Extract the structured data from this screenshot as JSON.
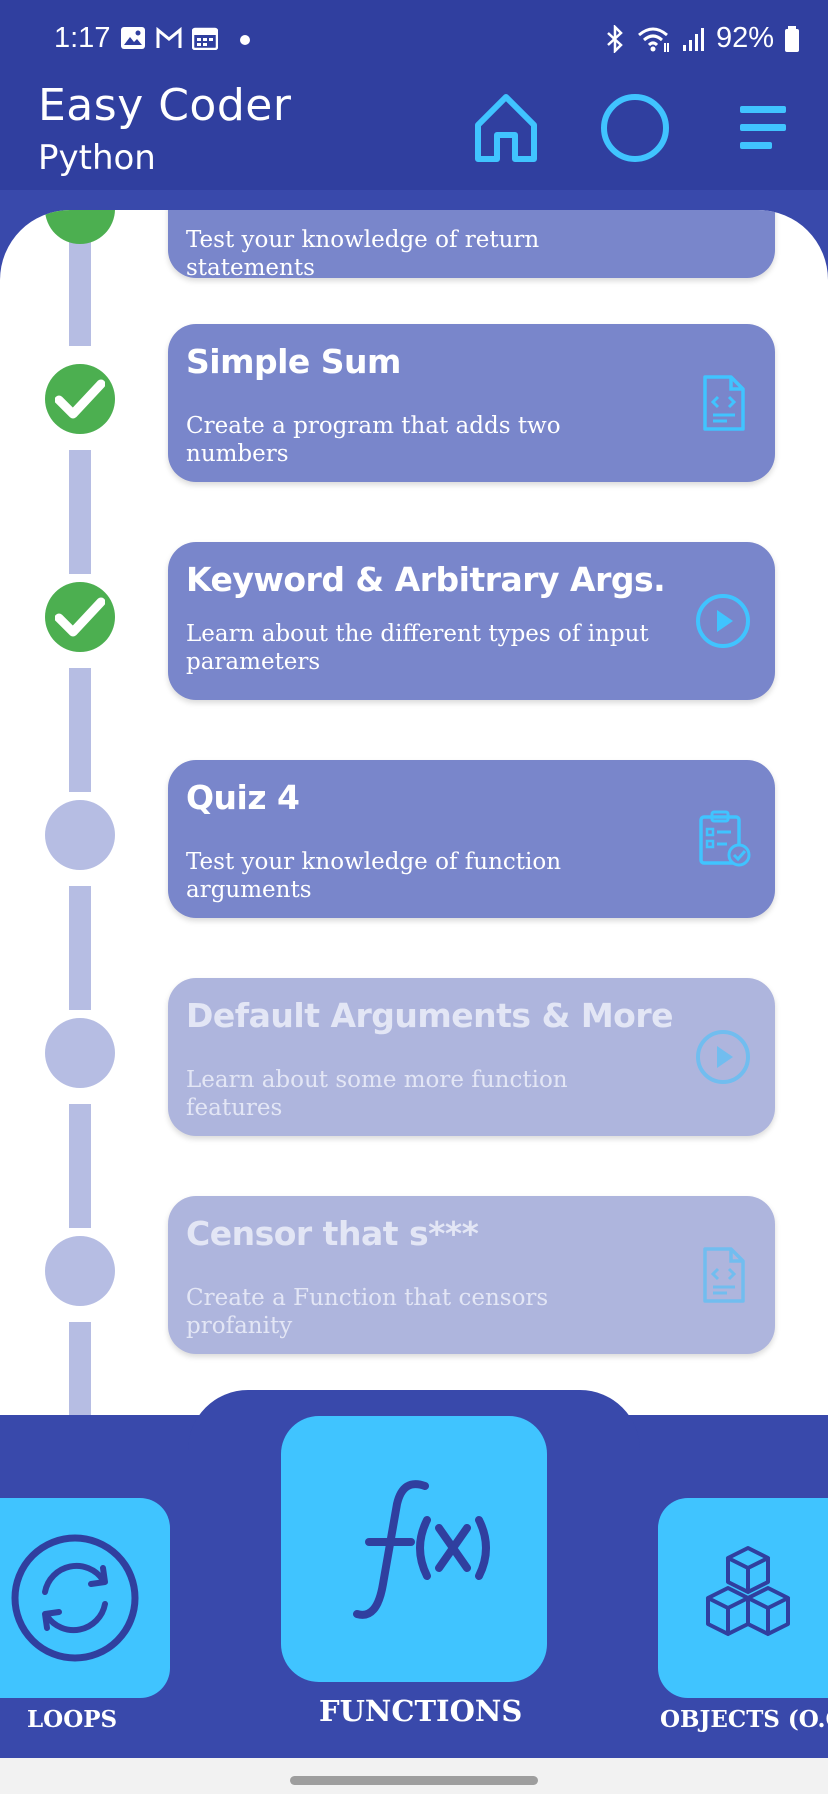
{
  "status_bar": {
    "time": "1:17",
    "battery": "92%"
  },
  "header": {
    "title": "Easy Coder",
    "subtitle": "Python"
  },
  "lessons": [
    {
      "title": "",
      "desc": "Test your knowledge of return statements",
      "icon": "quiz-icon",
      "state": "done"
    },
    {
      "title": "Simple Sum",
      "desc": "Create a program that adds two numbers",
      "icon": "code-file-icon",
      "state": "done"
    },
    {
      "title": "Keyword & Arbitrary Args.",
      "desc": "Learn about the different types of input parameters",
      "icon": "play-icon",
      "state": "done"
    },
    {
      "title": "Quiz 4",
      "desc": "Test your knowledge of function arguments",
      "icon": "quiz-icon",
      "state": "available"
    },
    {
      "title": "Default Arguments & More",
      "desc": "Learn about some more function features",
      "icon": "play-icon",
      "state": "locked"
    },
    {
      "title": "Censor that s***",
      "desc": "Create a Function that censors profanity",
      "icon": "code-file-icon",
      "state": "locked"
    }
  ],
  "bottom_nav": {
    "left_label": "LOOPS",
    "center_label": "FUNCTIONS",
    "right_label": "OBJECTS (O.O."
  },
  "colors": {
    "primary": "#303f9f",
    "nav": "#3949ab",
    "card": "#7986cb",
    "card_locked": "#aeb5dd",
    "accent": "#40c4ff",
    "done": "#4caf50"
  }
}
